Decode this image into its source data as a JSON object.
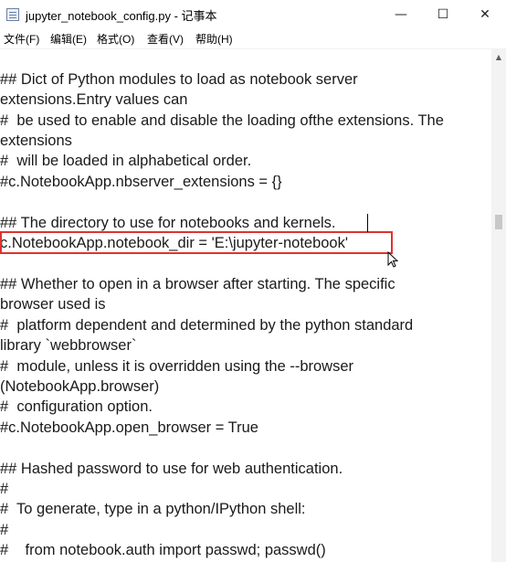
{
  "window": {
    "title": "jupyter_notebook_config.py - 记事本",
    "minimize_glyph": "—",
    "maximize_glyph": "☐",
    "close_glyph": "✕"
  },
  "menu": {
    "file": "文件(F)",
    "edit": "编辑(E)",
    "format": "格式(O)",
    "view": "查看(V)",
    "help": "帮助(H)"
  },
  "lines": [
    "## Dict of Python modules to load as notebook server",
    "extensions.Entry values can",
    "#  be used to enable and disable the loading ofthe extensions. The",
    "extensions",
    "#  will be loaded in alphabetical order.",
    "#c.NotebookApp.nbserver_extensions = {}",
    "## The directory to use for notebooks and kernels.",
    "c.NotebookApp.notebook_dir = 'E:\\jupyter-notebook'",
    "## Whether to open in a browser after starting. The specific",
    "browser used is",
    "#  platform dependent and determined by the python standard",
    "library `webbrowser`",
    "#  module, unless it is overridden using the --browser",
    "(NotebookApp.browser)",
    "#  configuration option.",
    "#c.NotebookApp.open_browser = True",
    "## Hashed password to use for web authentication.",
    "#",
    "#  To generate, type in a python/IPython shell:",
    "#",
    "#    from notebook.auth import passwd; passwd()"
  ],
  "icons": {
    "app": "notepad-icon",
    "pointer": "mouse-pointer-icon",
    "scroll_up": "chevron-up-icon"
  },
  "colors": {
    "highlight": "#e0322f"
  }
}
